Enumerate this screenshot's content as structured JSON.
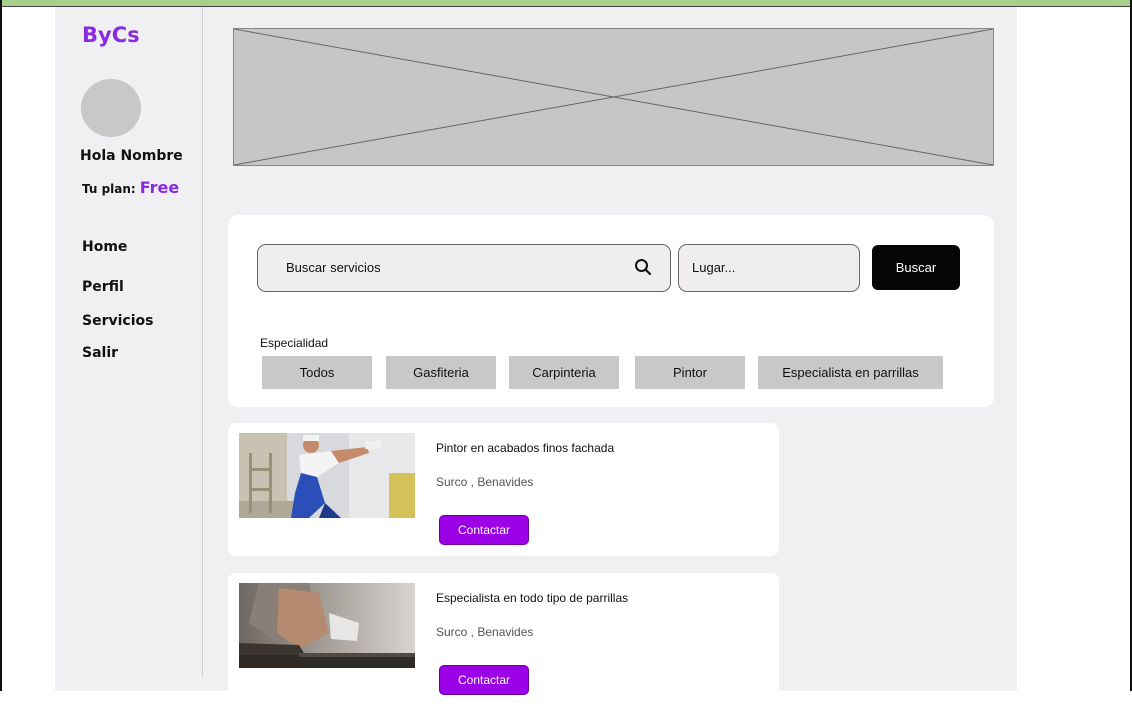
{
  "brand": {
    "name": "ByCs"
  },
  "user": {
    "greeting": "Hola Nombre",
    "plan_label": "Tu plan:",
    "plan_value": "Free"
  },
  "nav": {
    "items": [
      {
        "label": "Home"
      },
      {
        "label": "Perfil"
      },
      {
        "label": "Servicios"
      },
      {
        "label": "Salir"
      }
    ]
  },
  "search": {
    "query_placeholder": "Buscar servicios",
    "place_placeholder": "Lugar...",
    "button_label": "Buscar",
    "specialty_label": "Especialidad",
    "chips": [
      {
        "label": "Todos"
      },
      {
        "label": "Gasfiteria"
      },
      {
        "label": "Carpinteria"
      },
      {
        "label": "Pintor"
      },
      {
        "label": "Especialista en parrillas"
      }
    ]
  },
  "results": [
    {
      "title": "Pintor  en acabados finos fachada",
      "location": "Surco , Benavides",
      "button_label": "Contactar"
    },
    {
      "title": "Especialista en todo tipo de parrillas",
      "location": "Surco , Benavides",
      "button_label": "Contactar"
    }
  ],
  "icons": {
    "search": "search-icon",
    "hero": "image-placeholder-icon"
  },
  "colors": {
    "brand": "#8a2be2",
    "contact_button": "#9b00e6",
    "search_button": "#050505",
    "chip": "#c8c8c8"
  }
}
